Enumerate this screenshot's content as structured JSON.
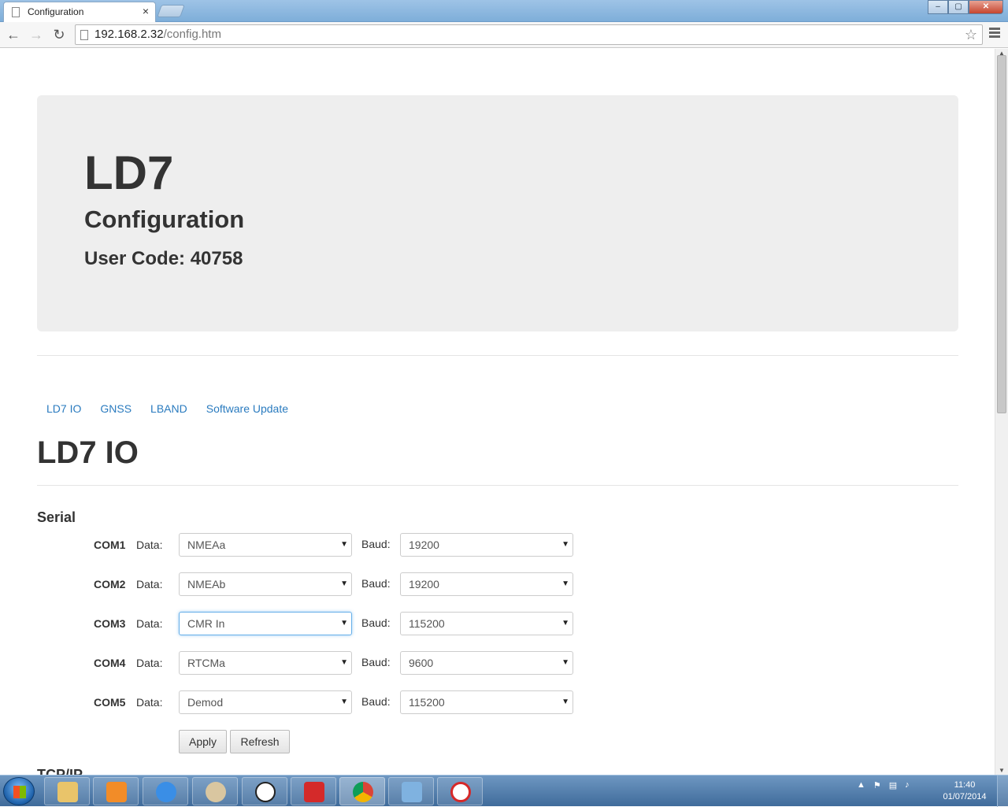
{
  "browser": {
    "tab_title": "Configuration",
    "tab_close": "×",
    "url_host": "192.168.2.32",
    "url_path": "/config.htm",
    "window_controls": [
      "–",
      "▢",
      "✕"
    ]
  },
  "header": {
    "title": "LD7",
    "subtitle": "Configuration",
    "user_code": "User Code: 40758"
  },
  "nav": {
    "links": [
      "LD7 IO",
      "GNSS",
      "LBAND",
      "Software Update"
    ]
  },
  "section": {
    "title": "LD7 IO",
    "serial_heading": "Serial",
    "data_label": "Data:",
    "baud_label": "Baud:",
    "rows": [
      {
        "port": "COM1",
        "data": "NMEAa",
        "baud": "19200"
      },
      {
        "port": "COM2",
        "data": "NMEAb",
        "baud": "19200"
      },
      {
        "port": "COM3",
        "data": "CMR In",
        "baud": "115200"
      },
      {
        "port": "COM4",
        "data": "RTCMa",
        "baud": "9600"
      },
      {
        "port": "COM5",
        "data": "Demod",
        "baud": "115200"
      }
    ],
    "apply_label": "Apply",
    "refresh_label": "Refresh",
    "next_heading": "TCP/IP"
  },
  "taskbar": {
    "time": "11:40",
    "date": "01/07/2014",
    "icons": [
      "file-explorer-icon",
      "media-player-icon",
      "internet-explorer-icon",
      "paint-icon",
      "compass-icon",
      "pdf-icon",
      "chrome-icon",
      "control-panel-icon",
      "target-icon"
    ]
  },
  "colors": {
    "link": "#2a7bbf",
    "jumbotron_bg": "#eeeeee",
    "focus": "#66afe9"
  }
}
